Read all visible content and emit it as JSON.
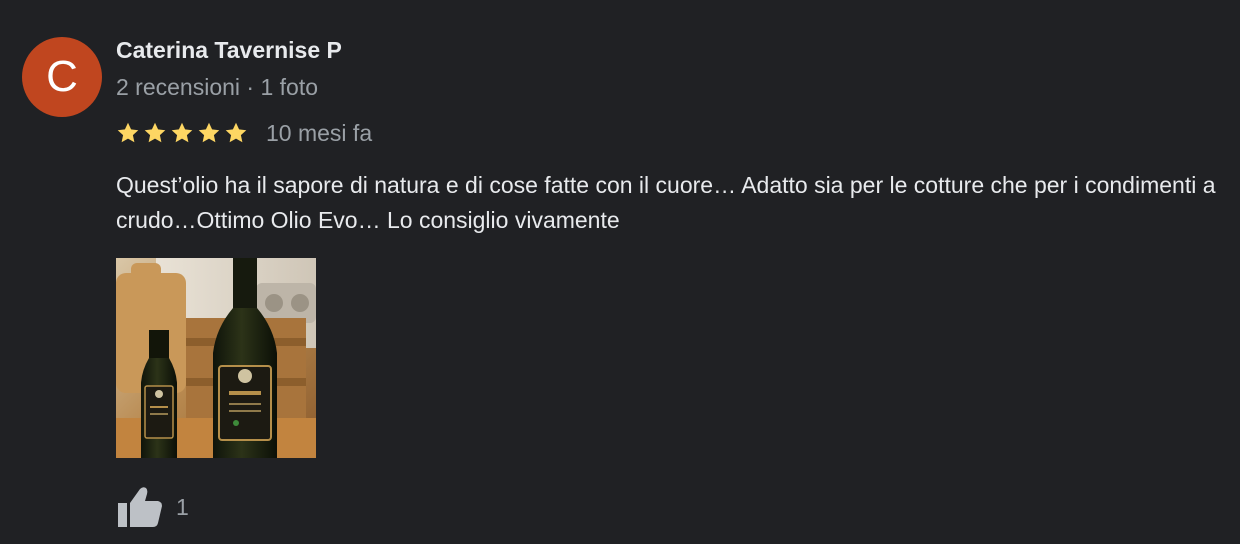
{
  "review": {
    "author": {
      "initial": "C",
      "name": "Caterina Tavernise P",
      "meta": "2 recensioni · 1 foto",
      "avatar_color": "#c0461f"
    },
    "rating": 5,
    "max_rating": 5,
    "star_icon": "star-icon",
    "star_color": "#fdd663",
    "date": "10 mesi fa",
    "text": "Quest’olio ha il sapore di natura e di cose fatte con il cuore… Adatto sia per le cotture che per i condimenti a crudo…Ottimo Olio Evo… Lo consiglio vivamente",
    "photo": {
      "label": "Flacone",
      "description_icon": "olive-oil-bottles-photo"
    },
    "likes": {
      "icon": "thumbs-up-icon",
      "count": "1"
    }
  }
}
